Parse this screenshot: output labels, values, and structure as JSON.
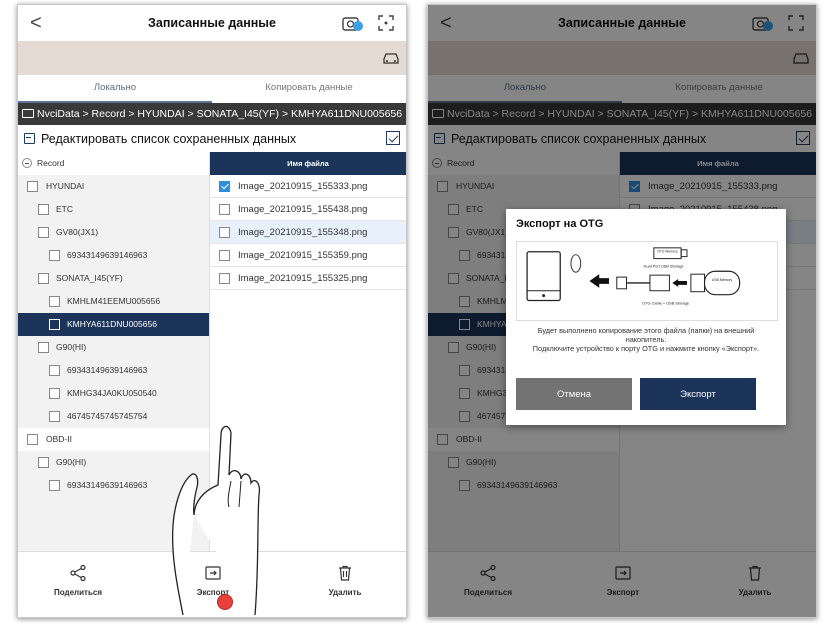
{
  "app": {
    "title": "Записанные данные",
    "back_glyph": "<",
    "icons": [
      "camera-icon",
      "scan-icon",
      "car-icon",
      "folder-icon",
      "share-icon",
      "export-icon",
      "trash-icon"
    ]
  },
  "tabs": [
    {
      "label": "Локально",
      "active": true
    },
    {
      "label": "Копировать данные",
      "active": false
    }
  ],
  "breadcrumb_left": "NvciData > Record > HYUNDAI > SONATA_I45(YF) > KMHYA611DNU005656",
  "breadcrumb_right": "NvciData > Record > HYUNDAI > SONATA_I45(YF) > KMHYA611DNU005656",
  "edit_label": "Редактировать список сохраненных данных",
  "tree": [
    {
      "label": "Record",
      "type": "root"
    },
    {
      "label": "HYUNDAI",
      "level": 1
    },
    {
      "label": "ETC",
      "level": 2
    },
    {
      "label": "GV80(JX1)",
      "level": 2
    },
    {
      "label": "69343149639146963",
      "level": 3
    },
    {
      "label": "SONATA_I45(YF)",
      "level": 2
    },
    {
      "label": "KMHLM41EEMU005656",
      "level": 3
    },
    {
      "label": "KMHYA611DNU005656",
      "level": 3,
      "selected": true
    },
    {
      "label": "G90(HI)",
      "level": 2
    },
    {
      "label": "69343149639146963",
      "level": 3
    },
    {
      "label": "KMHG34JA0KU050540",
      "level": 3
    },
    {
      "label": "46745745745745754",
      "level": 3
    },
    {
      "label": "OBD-II",
      "level": 1
    },
    {
      "label": "G90(HI)",
      "level": 2
    },
    {
      "label": "69343149639146963",
      "level": 3
    }
  ],
  "files_header": "Имя файла",
  "files": [
    {
      "name": "Image_20210915_155333.png",
      "checked": true
    },
    {
      "name": "Image_20210915_155438.png",
      "checked": false
    },
    {
      "name": "Image_20210915_155348.png",
      "checked": false,
      "highlighted": true
    },
    {
      "name": "Image_20210915_155359.png",
      "checked": false
    },
    {
      "name": "Image_20210915_155325.png",
      "checked": false
    }
  ],
  "bottom": {
    "share": "Поделиться",
    "export": "Экспорт",
    "delete": "Удалить"
  },
  "dialog": {
    "title": "Экспорт на OTG",
    "message": "Будет выполнено копирование этого файла (папки) на внешний накопитель.\nПодключите устройство к порту OTG и нажмите кнопку «Экспорт».",
    "cancel": "Отмена",
    "export": "Экспорт",
    "illustration": {
      "otg_memory": "OTG Memory",
      "dual_port": "Dual Port USB Storage",
      "usb_memory": "USB Memory",
      "cable": "OTG Cable + USB Storage"
    }
  },
  "colors": {
    "navy": "#1c3459",
    "vehicle_bar": "#e4dad1",
    "breadcrumb_bg": "#393939",
    "check_blue": "#2f8fdd",
    "touch_red": "#e8413a"
  }
}
